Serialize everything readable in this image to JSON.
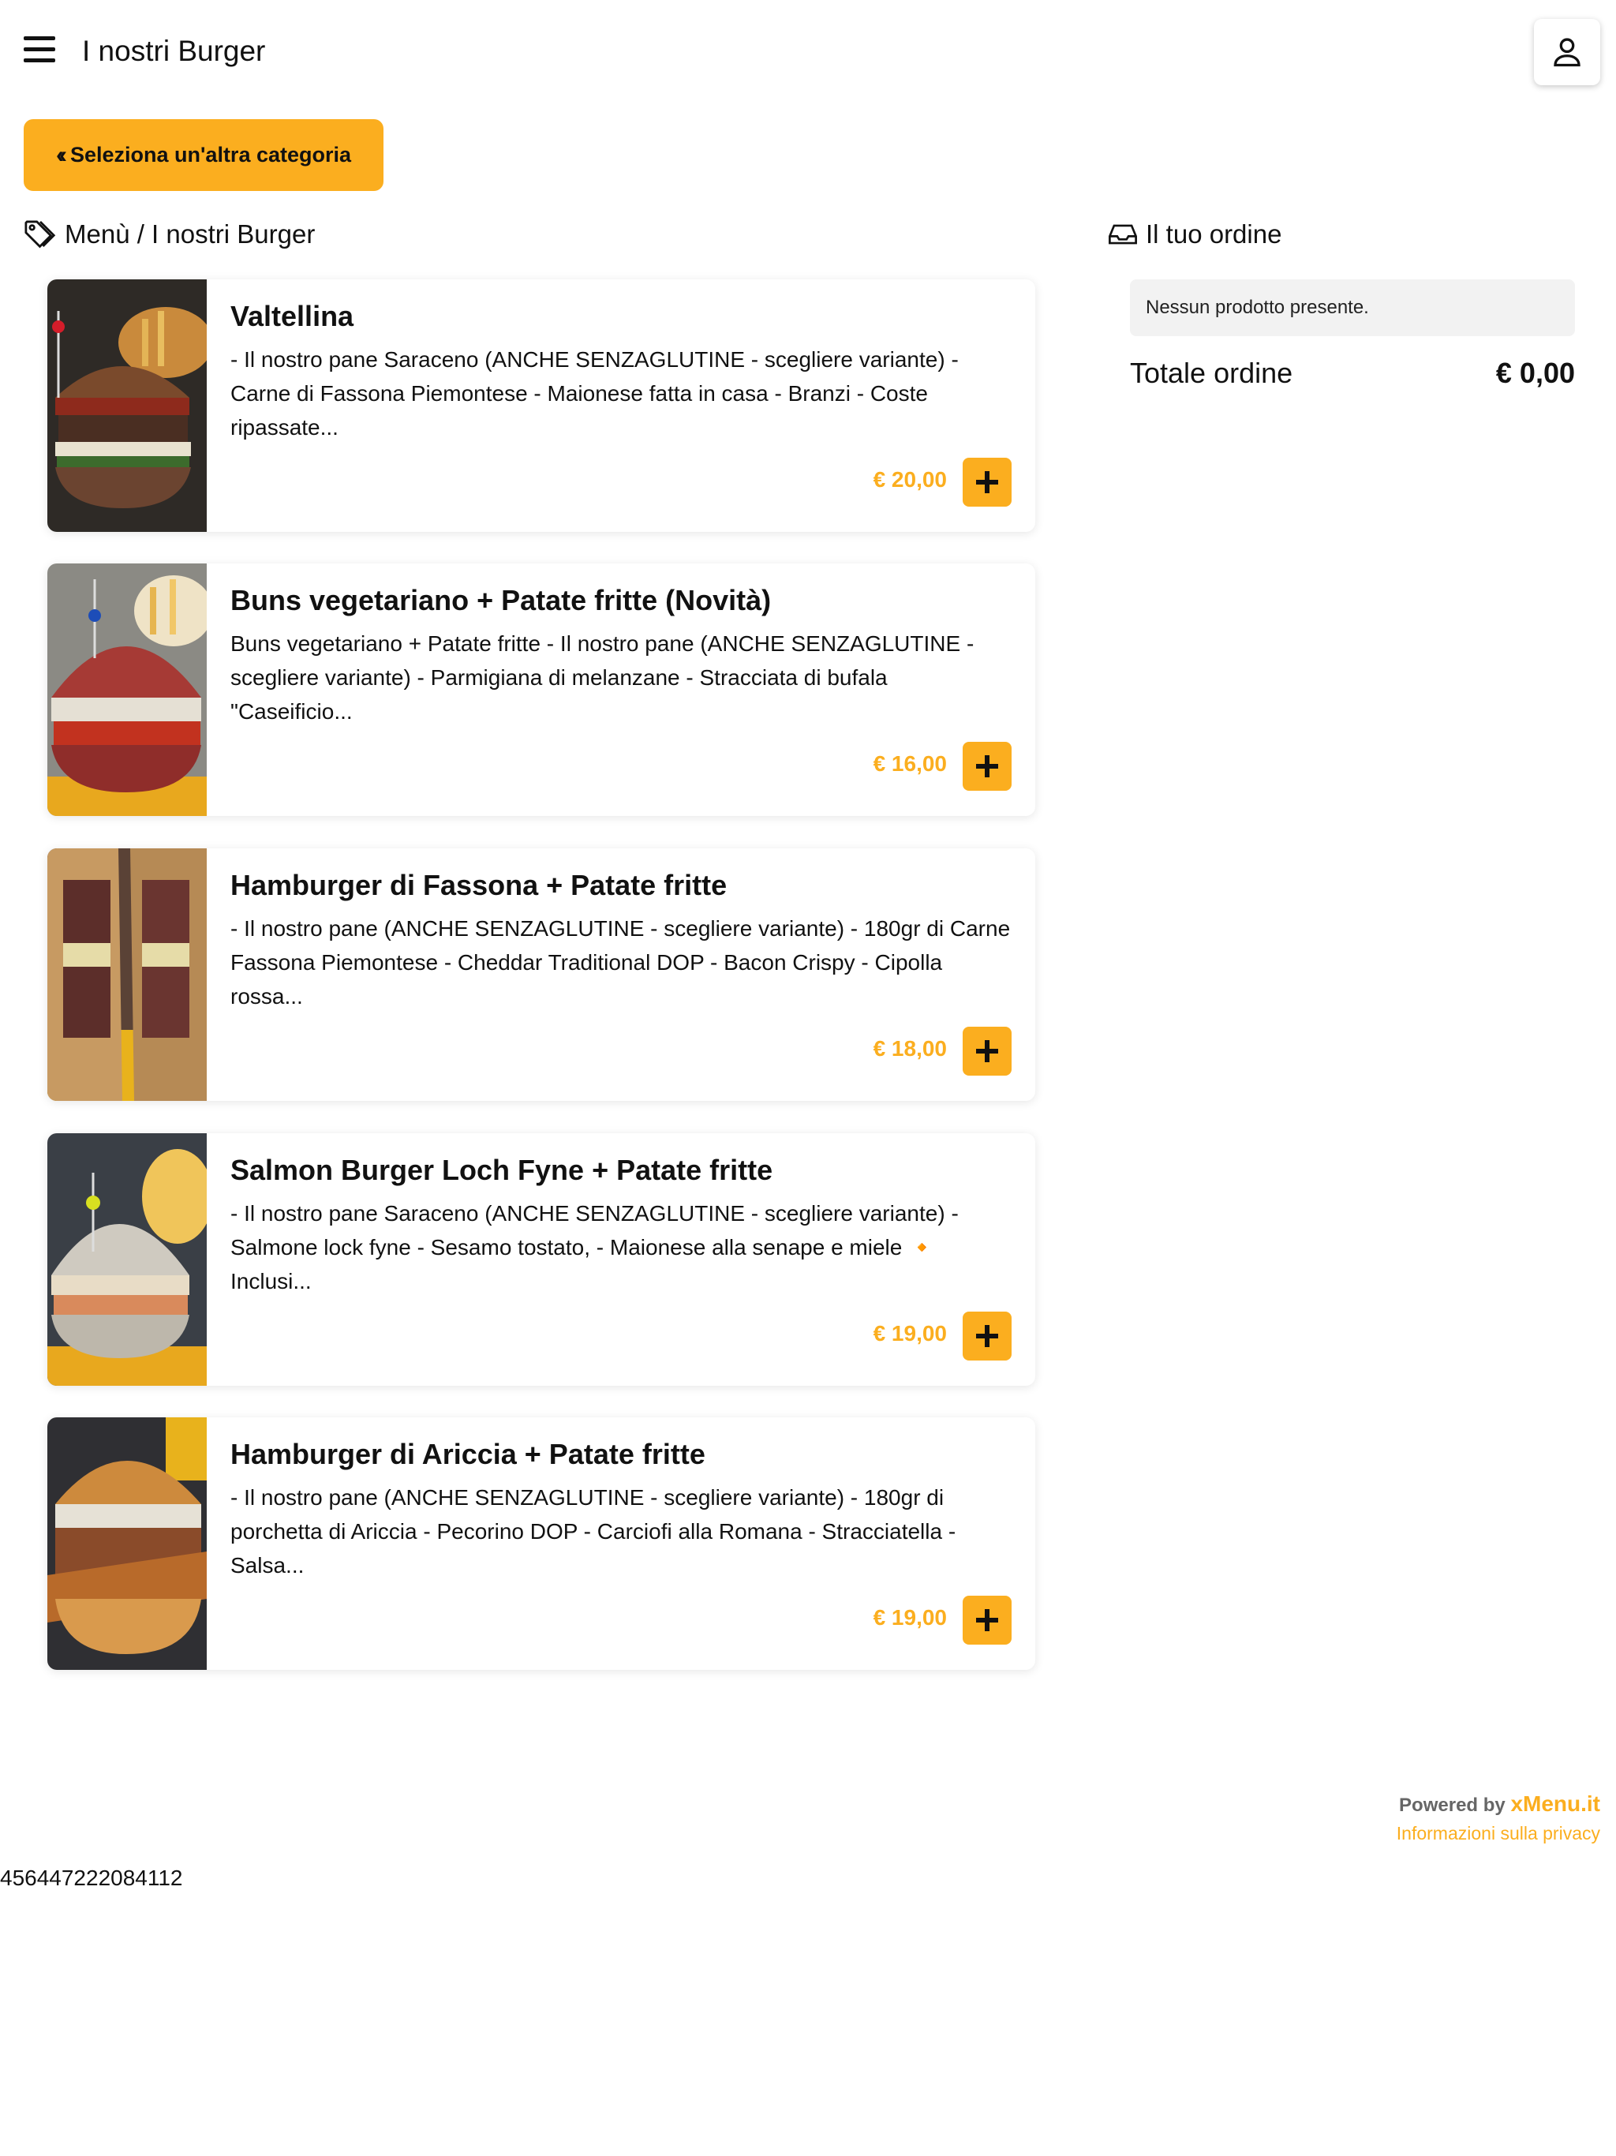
{
  "header": {
    "title": "I nostri Burger"
  },
  "category_button": {
    "icon": "double-chevron-left-icon",
    "label": "Seleziona un'altra categoria"
  },
  "breadcrumb": {
    "icon": "tag-icon",
    "text": "Menù / I nostri Burger"
  },
  "order": {
    "icon": "inbox-icon",
    "title": "Il tuo ordine",
    "empty_message": "Nessun prodotto presente.",
    "total_label": "Totale ordine",
    "total_value": "€ 0,00"
  },
  "products": [
    {
      "name": "Valtellina",
      "description": "- Il nostro pane Saraceno (ANCHE SENZAGLUTINE - scegliere variante) - Carne di Fassona Piemontese - Maionese fatta in casa - Branzi - Coste ripassate...",
      "price": "€ 20,00"
    },
    {
      "name": "Buns vegetariano + Patate fritte (Novità)",
      "description": "Buns vegetariano + Patate fritte - Il nostro pane (ANCHE SENZAGLUTINE - scegliere variante) - Parmigiana di melanzane - Stracciata di bufala \"Caseificio...",
      "price": "€ 16,00"
    },
    {
      "name": "Hamburger di Fassona + Patate fritte",
      "description": "- Il nostro pane (ANCHE SENZAGLUTINE - scegliere variante) - 180gr di Carne Fassona Piemontese - Cheddar Traditional DOP - Bacon Crispy - Cipolla rossa...",
      "price": "€ 18,00"
    },
    {
      "name": "Salmon Burger Loch Fyne + Patate fritte",
      "description": "- Il nostro pane Saraceno (ANCHE SENZAGLUTINE - scegliere variante) - Salmone lock fyne - Sesamo tostato, - Maionese alla senape e miele 🔸 Inclusi...",
      "price": "€ 19,00"
    },
    {
      "name": "Hamburger di Ariccia + Patate fritte",
      "description": "- Il nostro pane (ANCHE SENZAGLUTINE - scegliere variante) - 180gr di porchetta di Ariccia - Pecorino DOP - Carciofi alla Romana - Stracciatella - Salsa...",
      "price": "€ 19,00"
    }
  ],
  "footer": {
    "powered_by": "Powered by",
    "brand": "xMenu.it",
    "privacy": "Informazioni sulla privacy",
    "id": "456447222084112"
  },
  "colors": {
    "accent": "#fbae1f",
    "text": "#111111",
    "panel": "#f2f2f2"
  }
}
